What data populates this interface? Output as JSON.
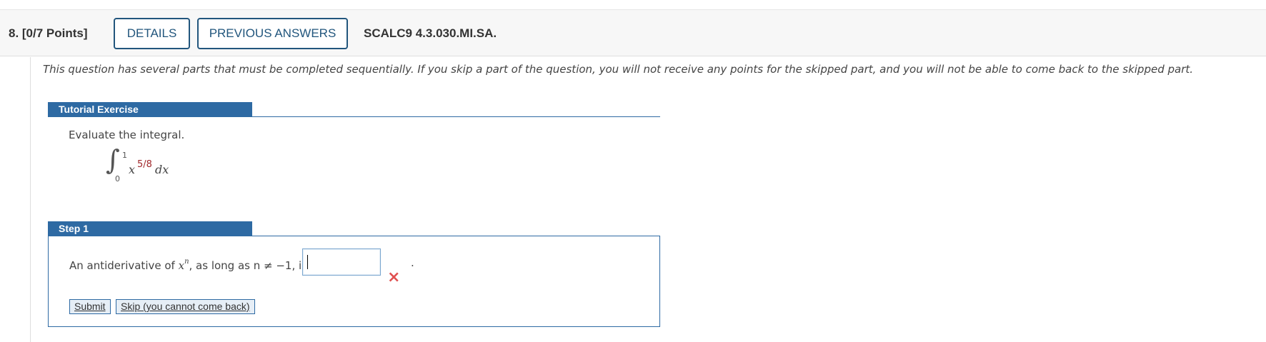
{
  "header": {
    "question_points": "8.  [0/7 Points]",
    "details_label": "DETAILS",
    "previous_answers_label": "PREVIOUS ANSWERS",
    "question_id": "SCALC9 4.3.030.MI.SA."
  },
  "notice": "This question has several parts that must be completed sequentially. If you skip a part of the question, you will not receive any points for the skipped part, and you will not be able to come back to the skipped part.",
  "tutorial": {
    "tab_label": "Tutorial Exercise",
    "prompt": "Evaluate the integral.",
    "integral": {
      "sign": "∫",
      "upper_limit": "1",
      "lower_limit": "0",
      "base": "x",
      "exponent": "5/8",
      "differential": "dx"
    }
  },
  "step1": {
    "tab_label": "Step 1",
    "text_before": "An antiderivative of ",
    "var_x": "x",
    "var_n": "n",
    "text_middle": ", as long as ",
    "condition": "n ≠ −1, is",
    "answer_value": "",
    "status_icon": "×",
    "trailing": ".",
    "submit_label": "Submit",
    "skip_label": "Skip (you cannot come back)"
  },
  "colors": {
    "accent": "#2e6aa3",
    "button_border": "#22567d",
    "exponent": "#a0282b",
    "error": "#e05050"
  }
}
